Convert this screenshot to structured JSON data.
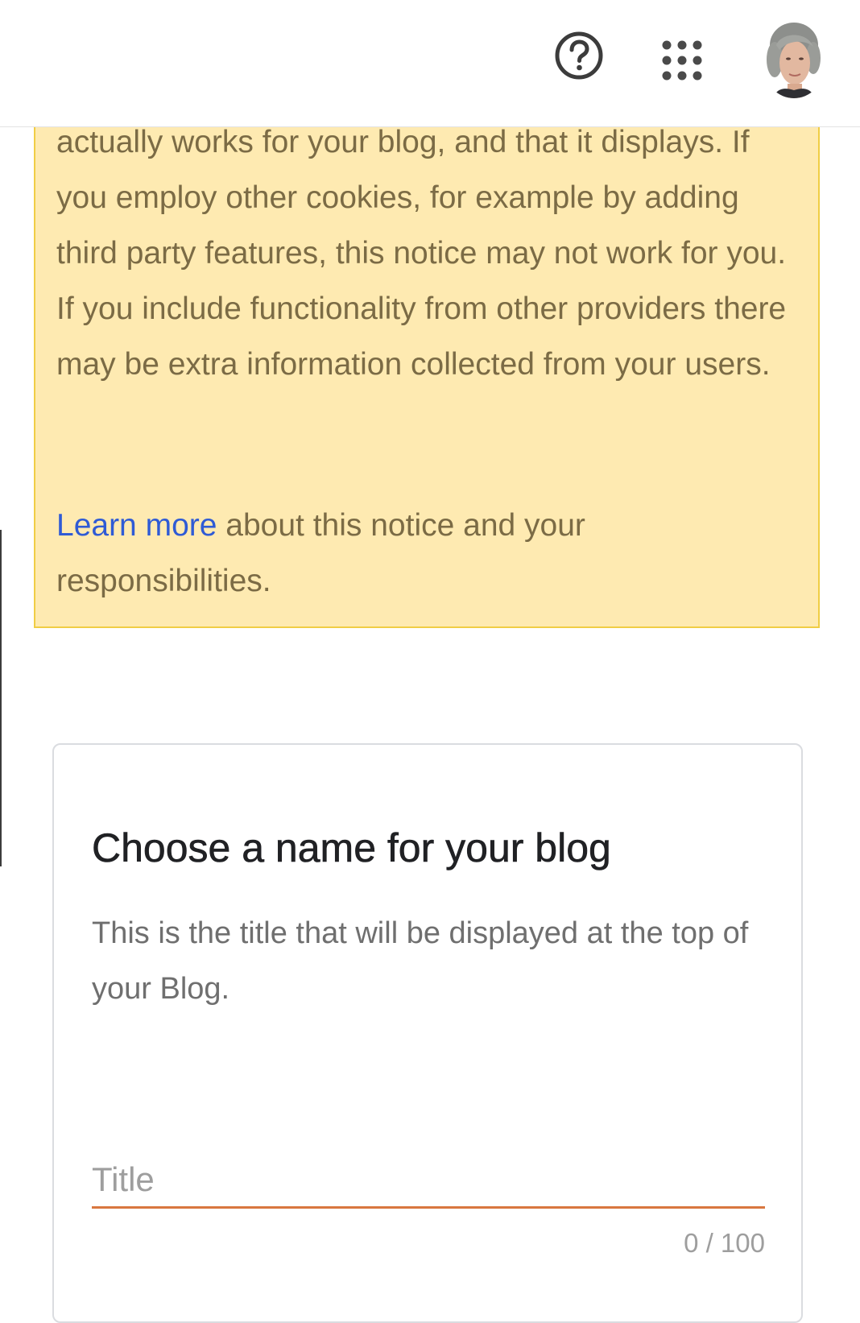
{
  "header": {
    "help_icon": "help-circle-icon",
    "apps_icon": "apps-grid-icon",
    "avatar": "user-avatar"
  },
  "notice": {
    "text": "actually works for your blog, and that it displays. If you employ other cookies, for example by adding third party features, this notice may not work for you. If you include functionality from other providers there may be extra information collected from your users.",
    "link_label": "Learn more",
    "after_link": " about this notice and your responsibilities.",
    "background_color": "#feeab1",
    "border_color": "#f0cd45"
  },
  "card": {
    "title": "Choose a name for your blog",
    "description": "This is the title that will be displayed at the top of your Blog.",
    "input_placeholder": "Title",
    "input_value": "",
    "counter": "0 / 100",
    "accent_color": "#d9773f"
  }
}
